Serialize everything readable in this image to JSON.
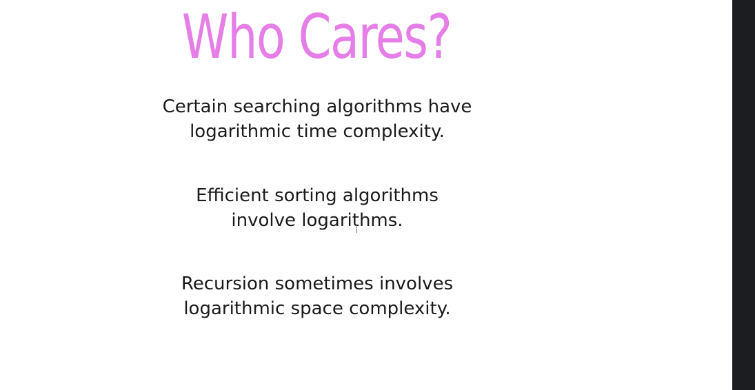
{
  "slide": {
    "title": "Who Cares?",
    "points": [
      {
        "line1": "Certain searching algorithms have",
        "line2": "logarithmic time complexity."
      },
      {
        "line1": "Efficient sorting algorithms",
        "line2": "involve logarithms."
      },
      {
        "line1": "Recursion sometimes involves",
        "line2": "logarithmic space complexity."
      }
    ]
  },
  "colors": {
    "title": "#e57ee6",
    "body_text": "#1a1a1a",
    "background": "#ffffff",
    "right_strip": "#1b1d20"
  }
}
